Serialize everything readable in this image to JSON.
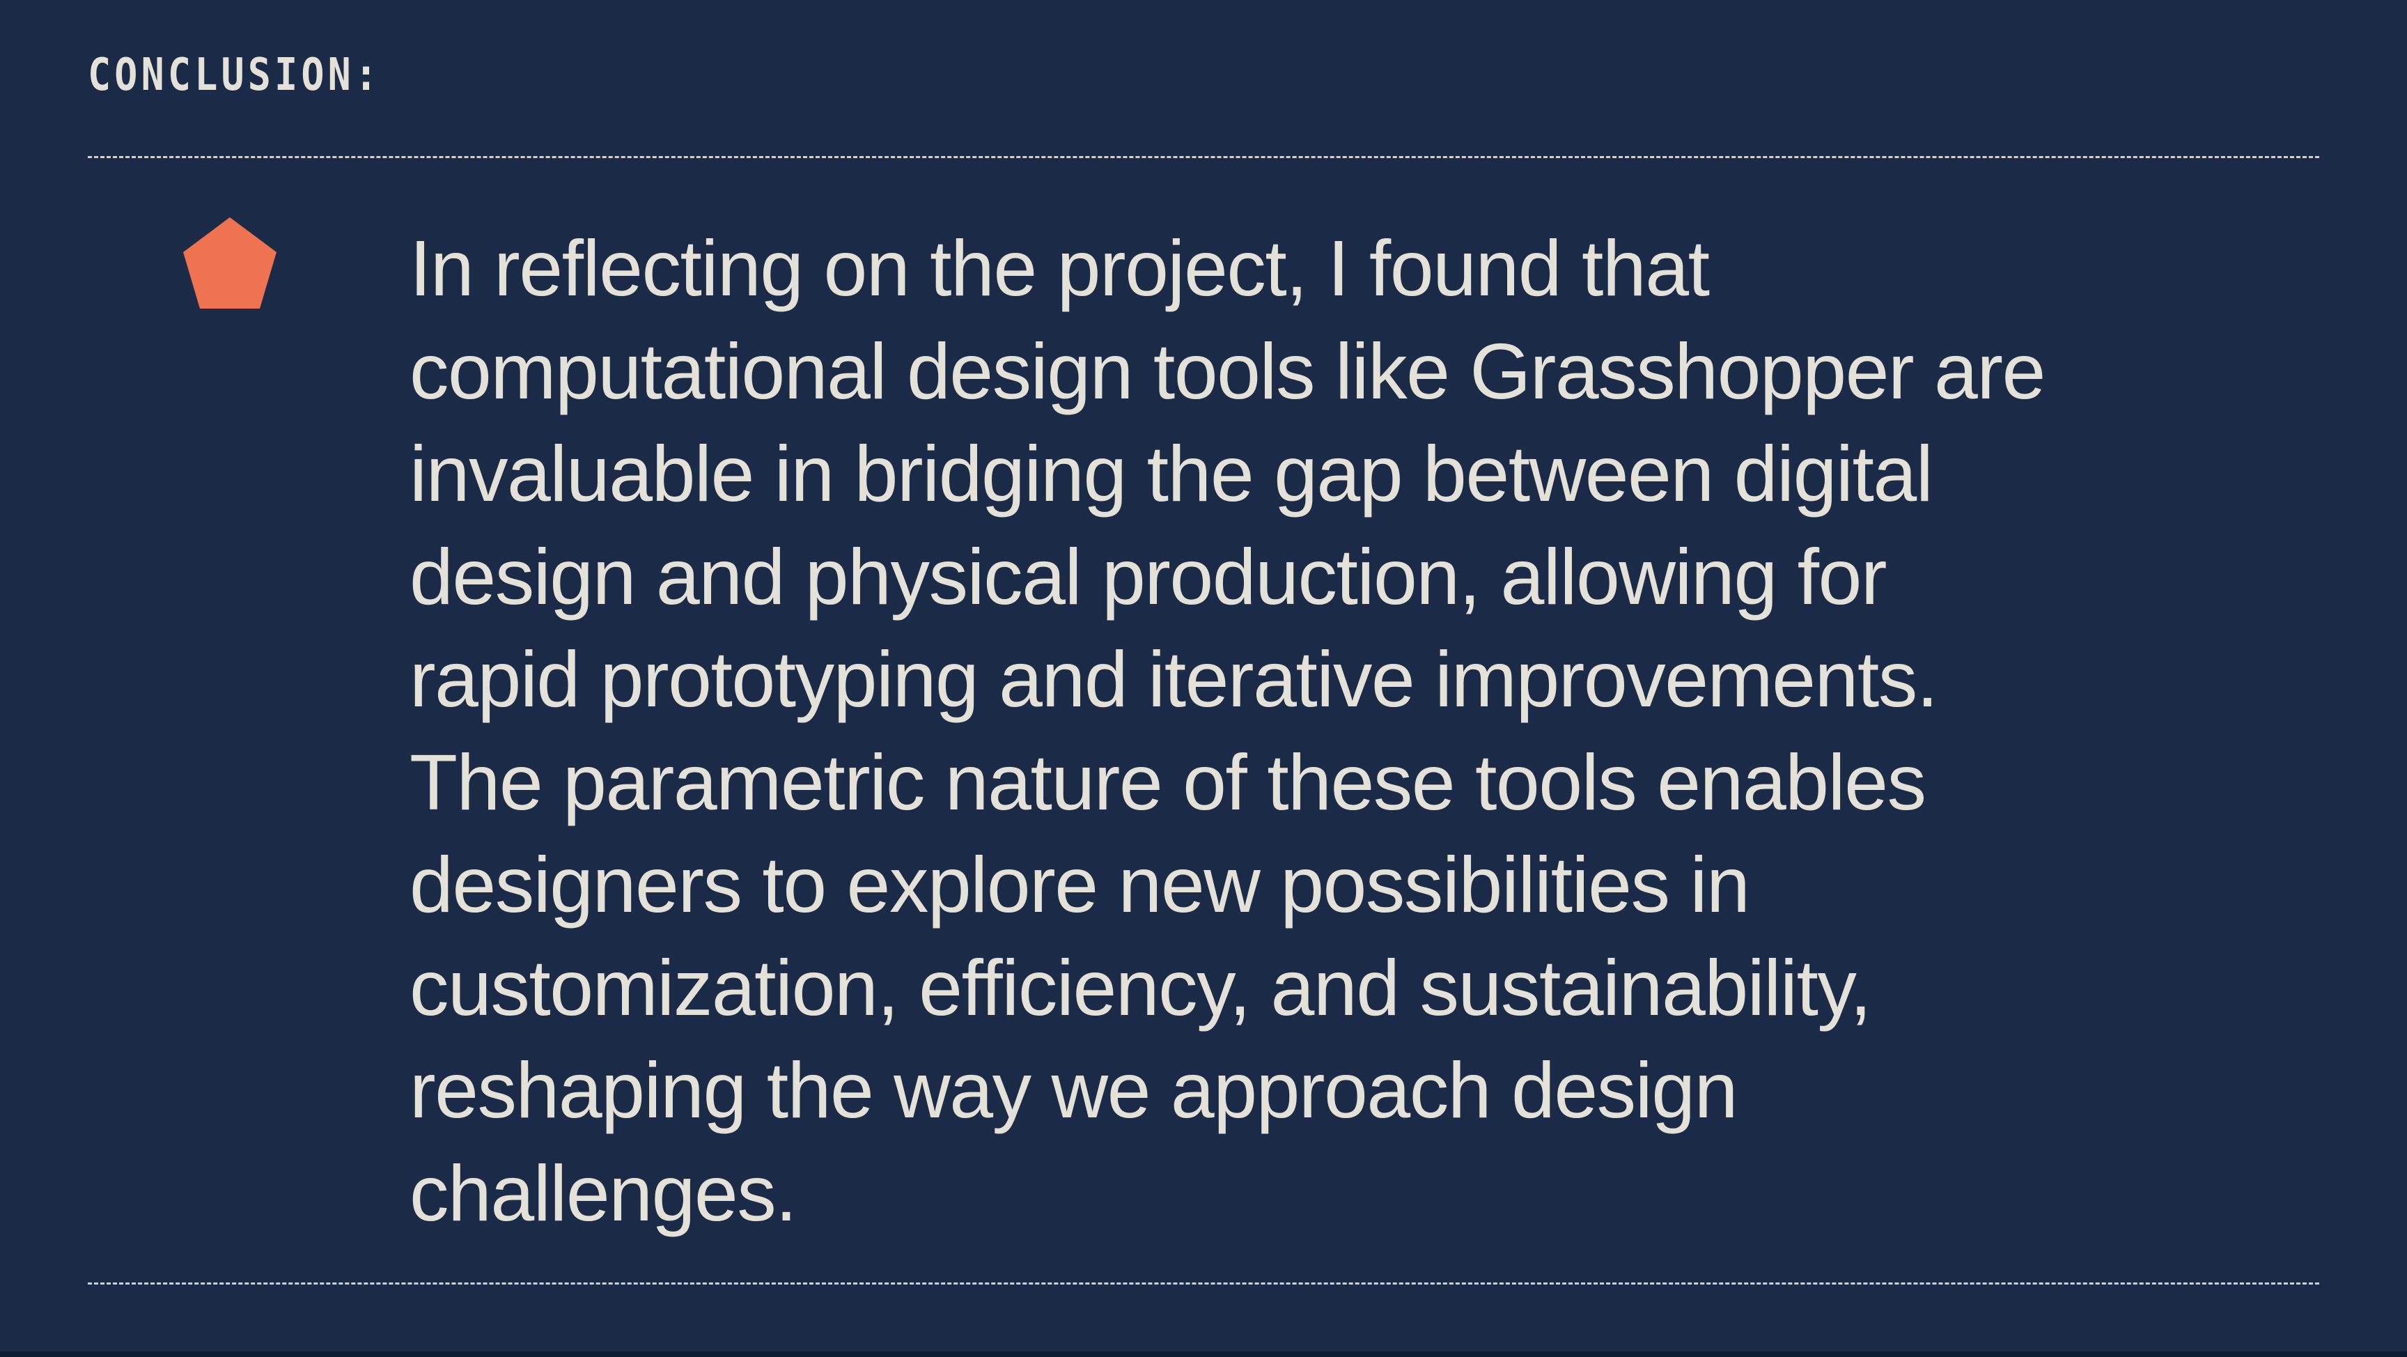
{
  "section": {
    "heading": "CONCLUSION:",
    "marker_icon": "pentagon-bullet-icon",
    "accent_color": "#ee7451",
    "text_lines": [
      "In reflecting on the project, I found that",
      "computational design tools like Grasshopper are",
      "invaluable in bridging the gap between digital",
      "design and physical production, allowing for",
      "rapid prototyping and iterative improvements.",
      "The parametric nature of these tools enables",
      "designers to explore new possibilities in",
      "customization, efficiency, and sustainability,",
      "reshaping the way we approach design",
      "challenges."
    ]
  },
  "colors": {
    "background": "#1a2a47",
    "text": "#e4e1d9"
  }
}
